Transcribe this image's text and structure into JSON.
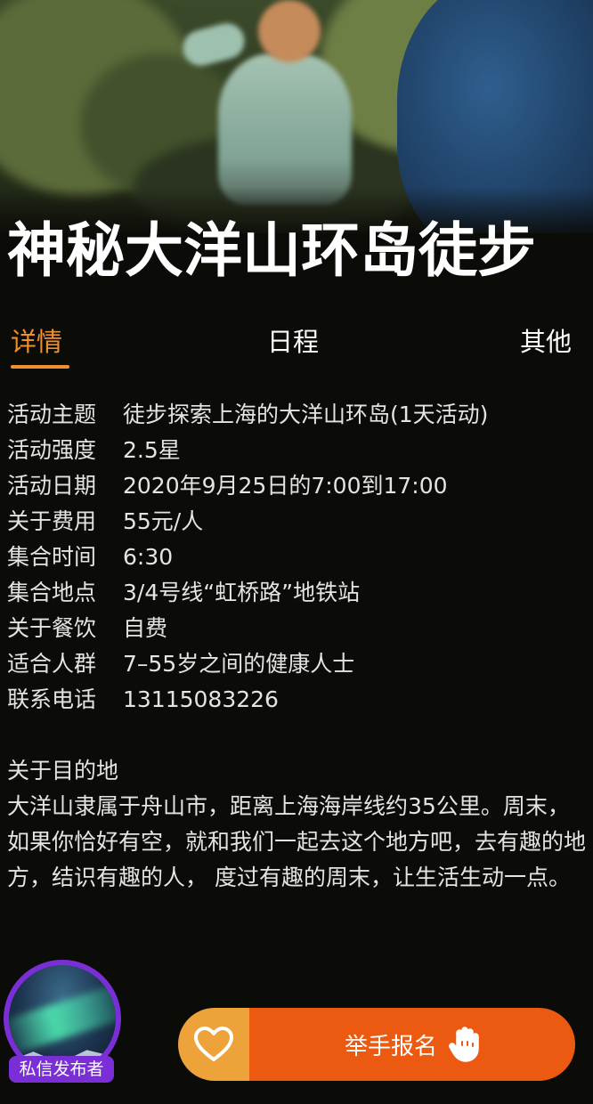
{
  "title": "神秘大洋山环岛徒步",
  "tabs": [
    {
      "label": "详情",
      "active": true
    },
    {
      "label": "日程",
      "active": false
    },
    {
      "label": "其他",
      "active": false
    }
  ],
  "details": [
    {
      "label": "活动主题",
      "value": "徒步探索上海的大洋山环岛(1天活动)"
    },
    {
      "label": "活动强度",
      "value": "2.5星"
    },
    {
      "label": "活动日期",
      "value": "2020年9月25日的7:00到17:00"
    },
    {
      "label": "关于费用",
      "value": "55元/人"
    },
    {
      "label": "集合时间",
      "value": "6:30"
    },
    {
      "label": "集合地点",
      "value": "3/4号线“虹桥路”地铁站"
    },
    {
      "label": "关于餐饮",
      "value": "自费"
    },
    {
      "label": "适合人群",
      "value": "7–55岁之间的健康人士"
    },
    {
      "label": "联系电话",
      "value": "13115083226"
    }
  ],
  "destination": {
    "title": "关于目的地",
    "body": "大洋山隶属于舟山市，距离上海海岸线约35公里。周末，如果你恰好有空，就和我们一起去这个地方吧，去有趣的地方，结识有趣的人， 度过有趣的周末，让生活生动一点。"
  },
  "publisher": {
    "dm_label": "私信发布者"
  },
  "actions": {
    "favorite_icon": "heart-icon",
    "signup_label": "举手报名",
    "signup_icon": "raised-hand-icon"
  },
  "colors": {
    "accent": "#f0902c",
    "signup": "#ec5a12",
    "favorite": "#eda33a",
    "publisher_ring": "#7a2fd6",
    "background": "#0b0b07"
  }
}
